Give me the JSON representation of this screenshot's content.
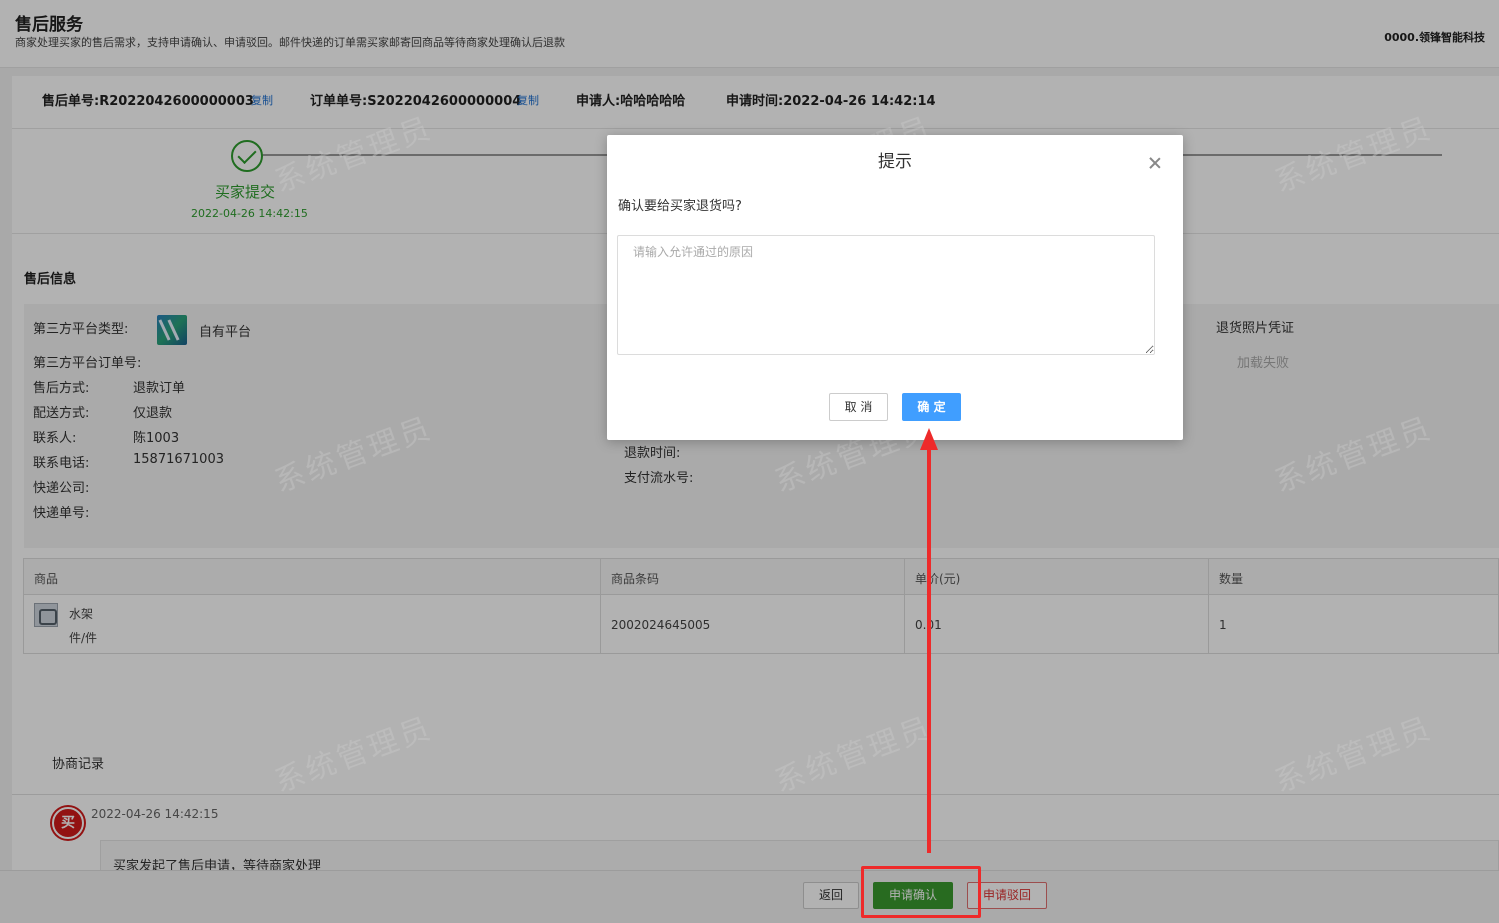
{
  "header": {
    "title": "售后服务",
    "subtitle": "商家处理买家的售后需求，支持申请确认、申请驳回。邮件快递的订单需买家邮寄回商品等待商家处理确认后退款",
    "company": "0000.领锋智能科技"
  },
  "order_bar": {
    "aftersale_no": "售后单号:R2022042600000003",
    "copy1": "复制",
    "order_no": "订单单号:S2022042600000004",
    "copy2": "复制",
    "applicant": "申请人:哈哈哈哈哈",
    "apply_time": "申请时间:2022-04-26 14:42:14"
  },
  "steps": {
    "step1_label": "买家提交",
    "step1_time": "2022-04-26 14:42:15"
  },
  "aftersale_info": {
    "section_title": "售后信息",
    "platform_type_label": "第三方平台类型:",
    "platform_type_value": "自有平台",
    "platform_order_label": "第三方平台订单号:",
    "method_label": "售后方式:",
    "method_value": "退款订单",
    "delivery_label": "配送方式:",
    "delivery_value": "仅退款",
    "contact_label": "联系人:",
    "contact_value": "陈1003",
    "phone_label": "联系电话:",
    "phone_value": "15871671003",
    "express_company_label": "快递公司:",
    "express_no_label": "快递单号:",
    "refund_time_label": "退款时间:",
    "pay_serial_label": "支付流水号:",
    "photo_label": "退货照片凭证",
    "photo_status": "加载失败"
  },
  "goods_table": {
    "headers": [
      "商品",
      "商品条码",
      "单价(元)",
      "数量"
    ],
    "rows": [
      {
        "name": "水架",
        "unit": "件/件",
        "barcode": "2002024645005",
        "price": "0.01",
        "qty": "1"
      }
    ]
  },
  "negotiation": {
    "title": "协商记录",
    "avatar_text": "买",
    "time": "2022-04-26 14:42:15",
    "message": "买家发起了售后申请，等待商家处理"
  },
  "footer": {
    "back_label": "返回",
    "confirm_label": "申请确认",
    "reject_label": "申请驳回"
  },
  "watermark_text": "系统管理员",
  "dialog": {
    "title": "提示",
    "message": "确认要给买家退货吗?",
    "placeholder": "请输入允许通过的原因",
    "cancel_label": "取 消",
    "ok_label": "确 定"
  },
  "colors": {
    "accent_blue": "#409eff",
    "confirm_green": "#3a9a2f",
    "annotation_red": "#ee2a2a"
  }
}
